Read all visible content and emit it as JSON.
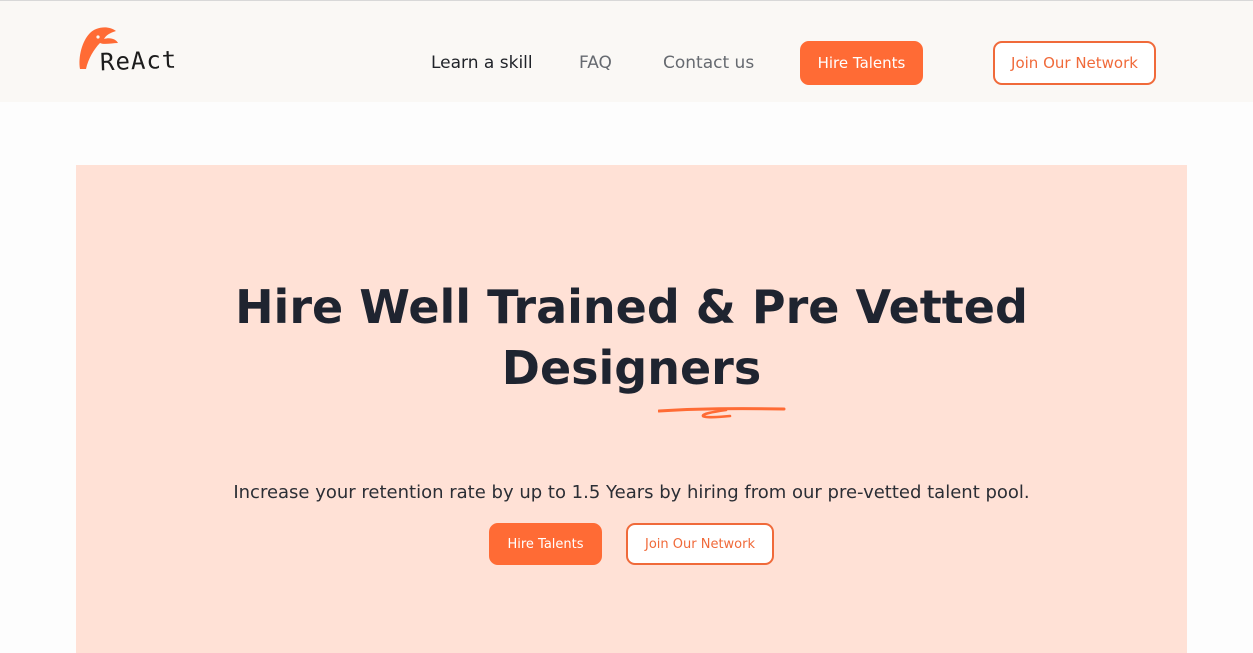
{
  "brand": {
    "logo_text": "ReAct",
    "accent_color": "#ff6b35"
  },
  "nav": {
    "links": [
      {
        "label": "Learn a skill"
      },
      {
        "label": "FAQ"
      },
      {
        "label": "Contact us"
      }
    ],
    "hire_button": "Hire Talents",
    "join_button": "Join Our Network"
  },
  "hero": {
    "title_line1": "Hire Well Trained & Pre Vetted",
    "title_line2": "Designers",
    "subtitle": "Increase your retention rate by up to 1.5 Years by hiring from our pre-vetted talent pool.",
    "hire_button": "Hire Talents",
    "join_button": "Join Our Network",
    "background_color": "#ffe1d6"
  }
}
